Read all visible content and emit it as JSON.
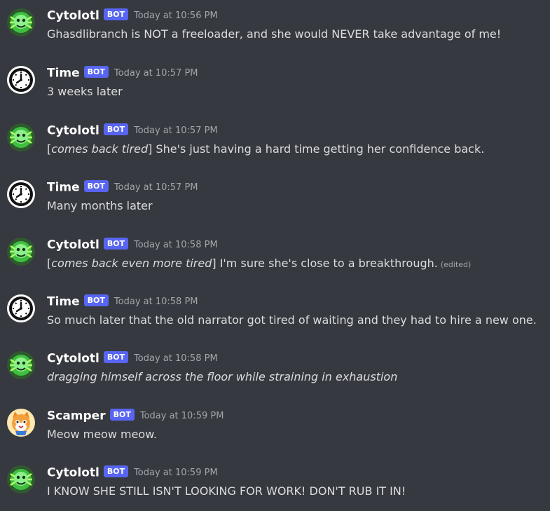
{
  "users": {
    "cytolotl": {
      "name": "Cytolotl",
      "badge": "BOT",
      "avatar_icon": "green-axolotl-avatar-icon"
    },
    "time": {
      "name": "Time",
      "badge": "BOT",
      "avatar_icon": "clock-avatar-icon"
    },
    "scamper": {
      "name": "Scamper",
      "badge": "BOT",
      "avatar_icon": "orange-cat-avatar-icon"
    }
  },
  "messages": [
    {
      "author": "Cytolotl",
      "badge": "BOT",
      "timestamp": "Today at 10:56 PM",
      "before": "",
      "italic": "",
      "text": "Ghasdlibranch is NOT a freeloader, and she would NEVER take advantage of me!",
      "edited": ""
    },
    {
      "author": "Time",
      "badge": "BOT",
      "timestamp": "Today at 10:57 PM",
      "before": "",
      "italic": "",
      "text": "3 weeks later",
      "edited": ""
    },
    {
      "author": "Cytolotl",
      "badge": "BOT",
      "timestamp": "Today at 10:57 PM",
      "before": "[",
      "italic": "comes back tired",
      "text": "] She's just having a hard time getting her confidence back.",
      "edited": ""
    },
    {
      "author": "Time",
      "badge": "BOT",
      "timestamp": "Today at 10:57 PM",
      "before": "",
      "italic": "",
      "text": "Many months later",
      "edited": ""
    },
    {
      "author": "Cytolotl",
      "badge": "BOT",
      "timestamp": "Today at 10:58 PM",
      "before": "[",
      "italic": "comes back even more tired",
      "text": "] I'm sure she's close to a breakthrough.",
      "edited": "(edited)"
    },
    {
      "author": "Time",
      "badge": "BOT",
      "timestamp": "Today at 10:58 PM",
      "before": "",
      "italic": "",
      "text": "So much later that the old narrator got tired of waiting and they had to hire a new one.",
      "edited": ""
    },
    {
      "author": "Cytolotl",
      "badge": "BOT",
      "timestamp": "Today at 10:58 PM",
      "before": "",
      "italic": "dragging himself across the floor while straining in exhaustion",
      "text": "",
      "edited": ""
    },
    {
      "author": "Scamper",
      "badge": "BOT",
      "timestamp": "Today at 10:59 PM",
      "before": "",
      "italic": "",
      "text": "Meow meow meow.",
      "edited": ""
    },
    {
      "author": "Cytolotl",
      "badge": "BOT",
      "timestamp": "Today at 10:59 PM",
      "before": "",
      "italic": "",
      "text": "I KNOW SHE STILL ISN'T LOOKING FOR WORK! DON'T RUB IT IN!",
      "edited": ""
    }
  ],
  "colors": {
    "background": "#36393f",
    "badge": "#5865f2",
    "author": "#ffffff",
    "text": "#dcddde",
    "timestamp": "#a3a6aa"
  }
}
